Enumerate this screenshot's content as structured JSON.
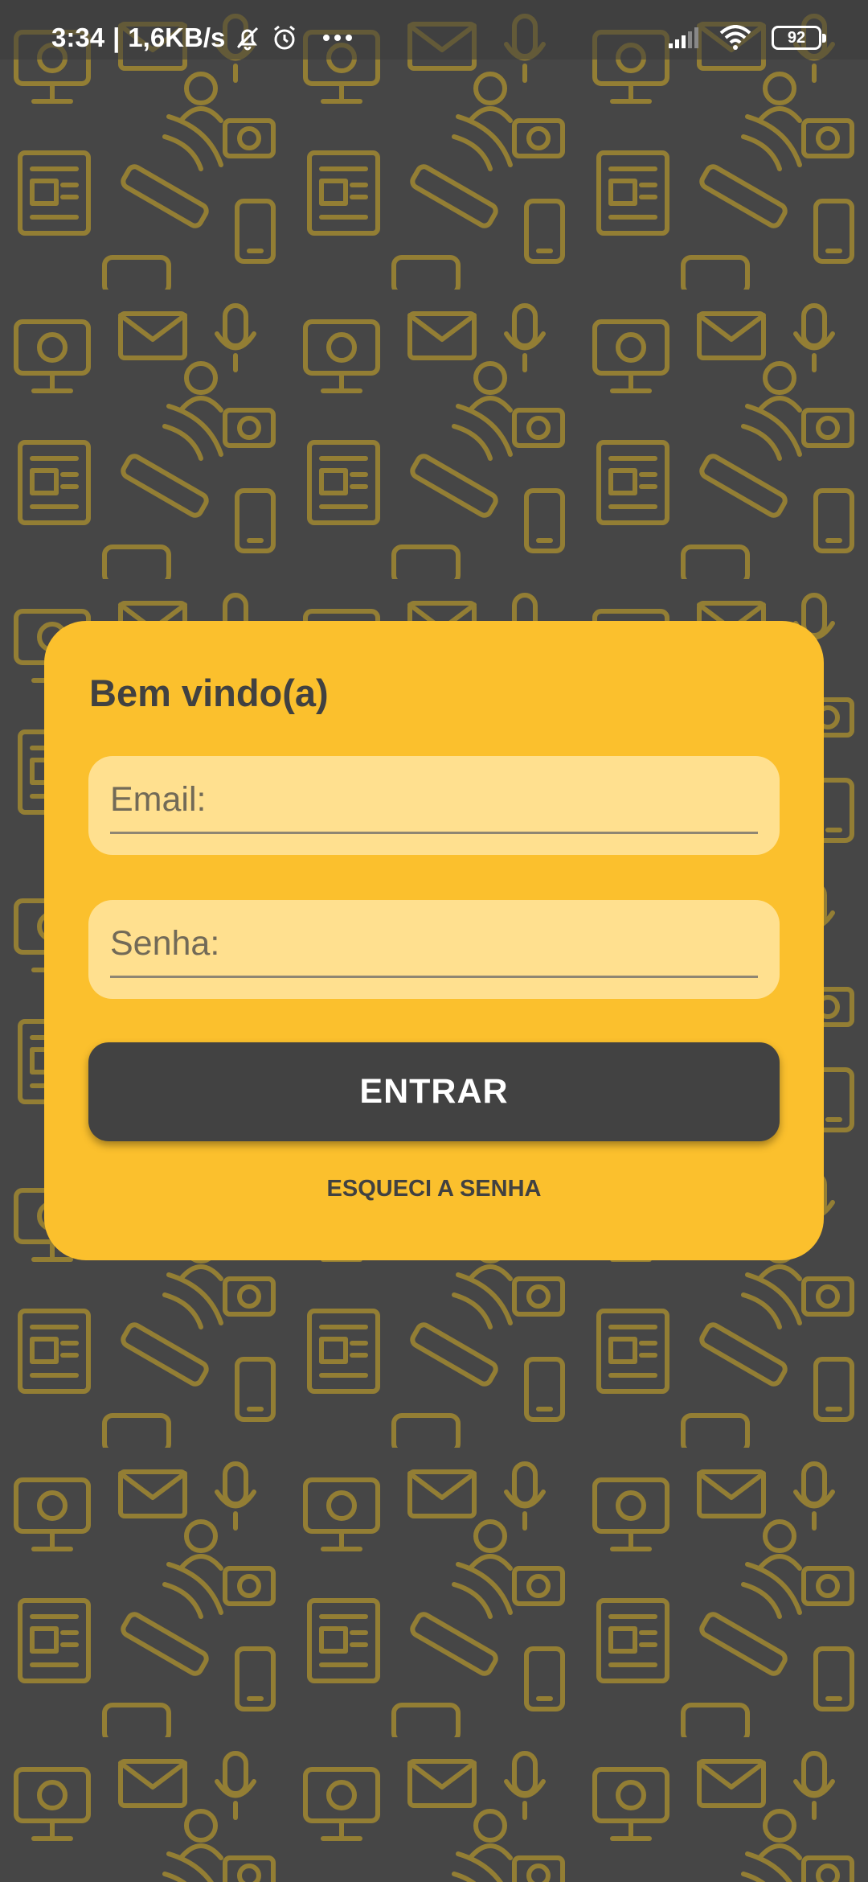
{
  "status_bar": {
    "time": "3:34",
    "separator": "|",
    "network_speed": "1,6KB/s",
    "battery_level": "92",
    "icons": [
      "notifications-muted-icon",
      "alarm-icon",
      "more-icon",
      "signal-icon",
      "wifi-icon",
      "battery-icon"
    ]
  },
  "background": {
    "color": "#464646",
    "pattern_color": "#9b8432"
  },
  "login_card": {
    "title": "Bem vindo(a)",
    "email_placeholder": "Email:",
    "password_placeholder": "Senha:",
    "submit_label": "ENTRAR",
    "forgot_password_label": "ESQUECI A SENHA",
    "card_color": "#fbc02d",
    "field_color": "#ffe08f",
    "button_color": "#424242"
  }
}
